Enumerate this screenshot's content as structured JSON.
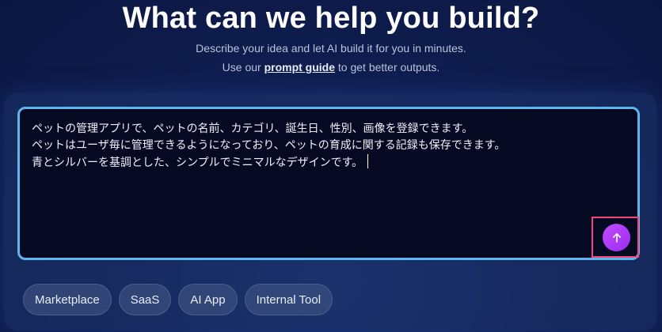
{
  "hero": {
    "title": "What can we help you build?",
    "subtitle": "Describe your idea and let AI build it for you in minutes.",
    "guide_prefix": "Use our ",
    "guide_link": "prompt guide",
    "guide_suffix": " to get better outputs."
  },
  "prompt": {
    "text": "ペットの管理アプリで、ペットの名前、カテゴリ、誕生日、性別、画像を登録できます。\nペットはユーザ毎に管理できるようになっており、ペットの育成に関する記録も保存できます。\n青とシルバーを基調とした、シンプルでミニマルなデザインです。",
    "send_icon": "arrow-up-icon"
  },
  "chips": [
    {
      "label": "Marketplace"
    },
    {
      "label": "SaaS"
    },
    {
      "label": "AI App"
    },
    {
      "label": "Internal Tool"
    }
  ],
  "colors": {
    "accent": "#b23cf5",
    "editor_border": "#5fb6ee",
    "highlight": "#f0487a"
  }
}
